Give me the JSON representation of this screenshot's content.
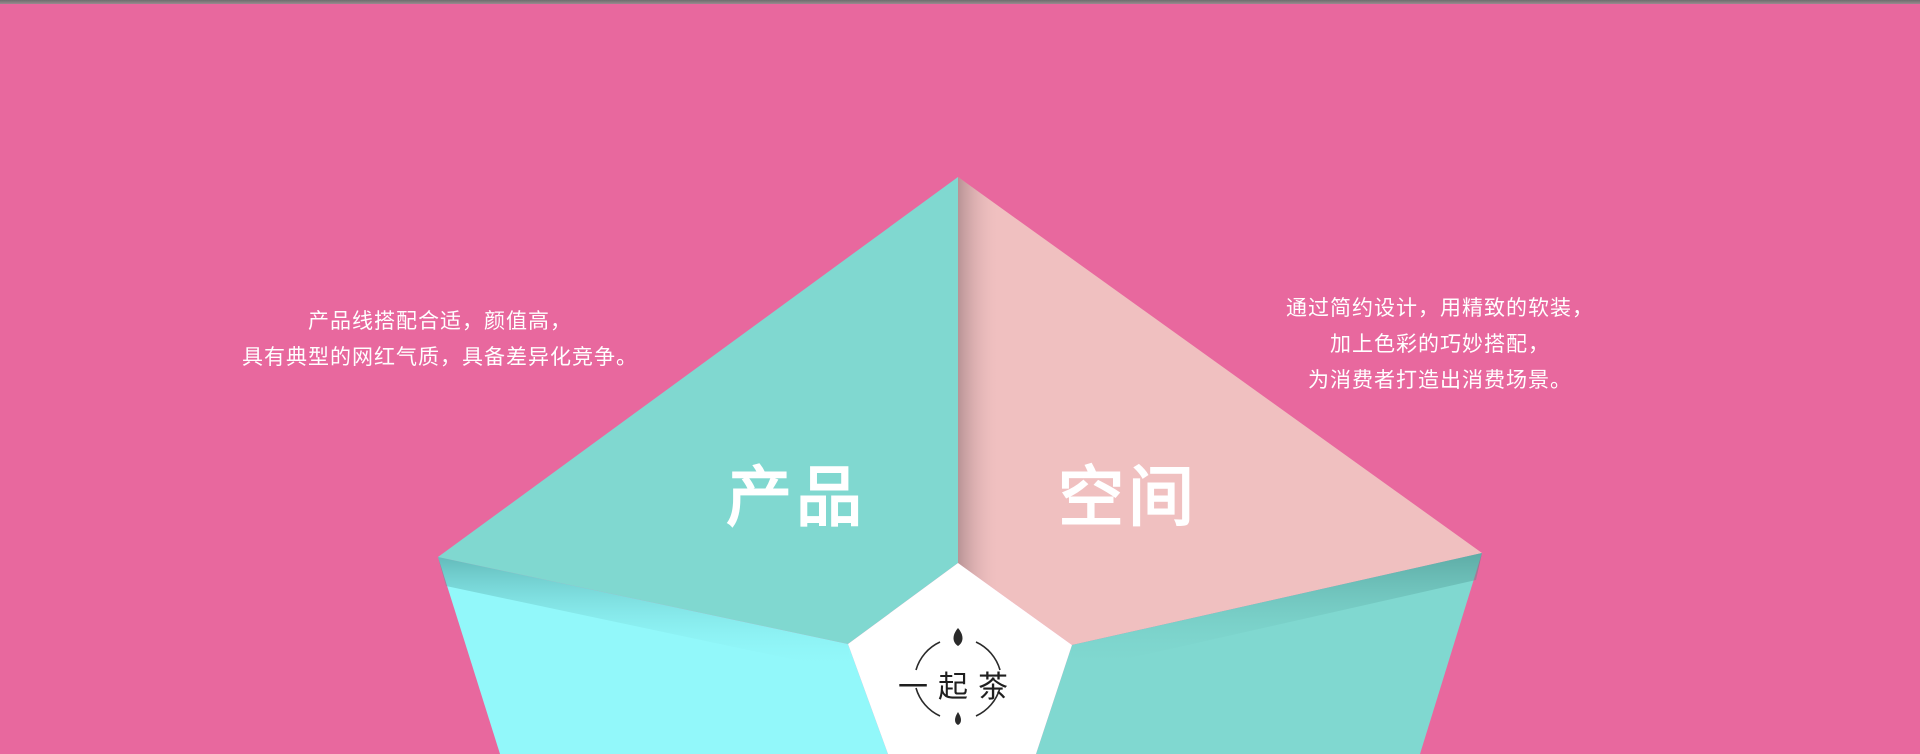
{
  "colors": {
    "background": "#e8689e",
    "teal": "#80d8d0",
    "pink": "#f0c0c0",
    "cyan": "#92f8fa",
    "center": "#ffffff"
  },
  "left_text": {
    "lines": [
      "产品线搭配合适，颜值高，",
      "具有典型的网红气质，具备差异化竞争。"
    ]
  },
  "right_text": {
    "lines": [
      "通过简约设计，用精致的软装，",
      "加上色彩的巧妙搭配，",
      "为消费者打造出消费场景。"
    ]
  },
  "segments": {
    "product": "产品",
    "space": "空间",
    "bottom_left": "",
    "bottom_right": ""
  },
  "logo": {
    "text": "一起茶",
    "icon": "tea-leaf-circle-icon"
  }
}
